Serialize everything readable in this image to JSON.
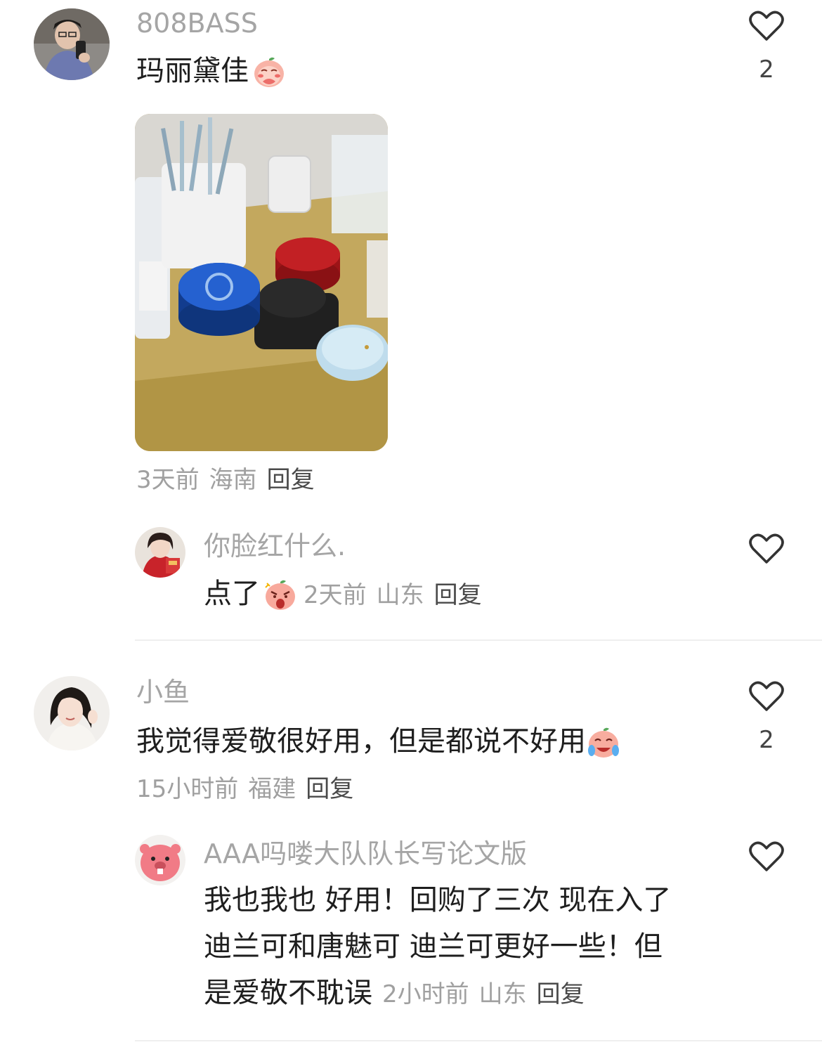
{
  "comments": [
    {
      "username": "808BASS",
      "text": "玛丽黛佳",
      "emoji": "shy-peach-emoji",
      "likes": "2",
      "time": "3天前",
      "location": "海南",
      "reply_label": "回复",
      "reply": {
        "username": "你脸红什么.",
        "text": "点了",
        "emoji": "shocked-peach-emoji",
        "time": "2天前",
        "location": "山东",
        "reply_label": "回复"
      }
    },
    {
      "username": "小鱼",
      "text": "我觉得爱敬很好用，但是都说不好用",
      "emoji": "crying-laugh-peach-emoji",
      "likes": "2",
      "time": "15小时前",
      "location": "福建",
      "reply_label": "回复",
      "reply": {
        "username": "AAA吗喽大队队长写论文版",
        "lines": [
          "我也我也 好用！回购了三次 现在入了",
          "迪兰可和唐魅可 迪兰可更好一些！但",
          "是爱敬不耽误"
        ],
        "time": "2小时前",
        "location": "山东",
        "reply_label": "回复"
      }
    }
  ],
  "colors": {
    "username": "#a5a5a5",
    "text": "#1e1e1e",
    "meta": "#a0a0a0",
    "divider": "#efefef"
  }
}
